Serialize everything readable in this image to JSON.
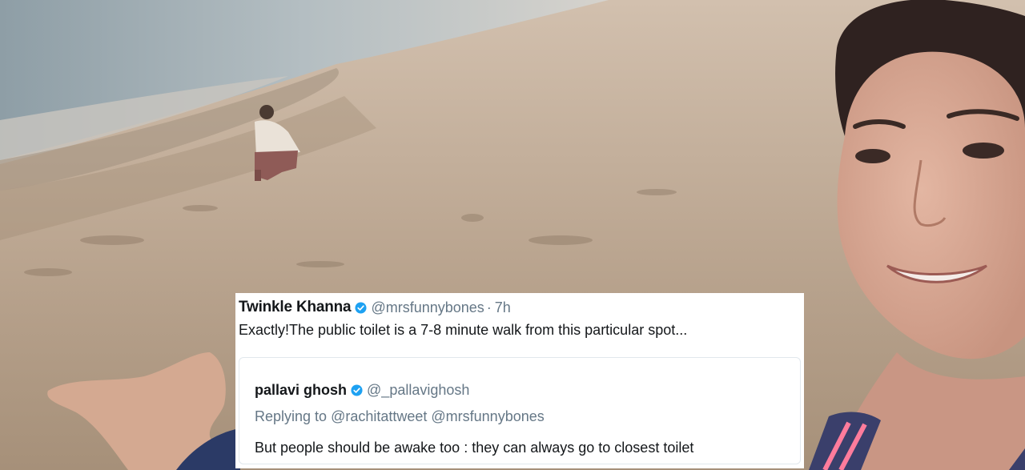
{
  "tweet": {
    "author_name": "Twinkle Khanna",
    "author_handle": "@mrsfunnybones",
    "separator": "·",
    "time": "7h",
    "text": "Exactly!The public toilet is a 7-8 minute walk from this particular spot..."
  },
  "quoted_tweet": {
    "author_name": "pallavi ghosh",
    "author_handle": "@_pallavighosh",
    "reply_prefix": "Replying to",
    "reply_mentions": "@rachitattweet @mrsfunnybones",
    "text": "But people should be awake too : they can always go to closest toilet"
  },
  "icons": {
    "verified": "verified-badge-icon"
  },
  "colors": {
    "verified_blue": "#1da1f2",
    "handle_gray": "#657786",
    "text_dark": "#14171a"
  }
}
